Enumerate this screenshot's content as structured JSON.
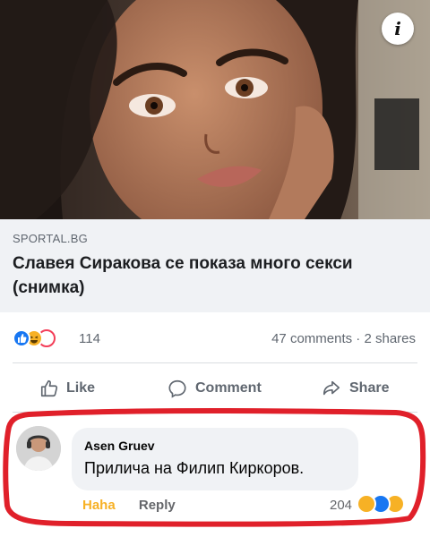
{
  "post": {
    "info_icon": "i",
    "source": "SPORTAL.BG",
    "headline": "Славея Сиракова се показа много секси (снимка)",
    "reaction_icons": [
      "like-icon",
      "haha-icon",
      "love-icon"
    ],
    "reaction_count": "114",
    "comments_shares": "47 comments · 2 shares"
  },
  "actions": {
    "like": "Like",
    "comment": "Comment",
    "share": "Share"
  },
  "comment": {
    "author": "Asen Gruev",
    "text": "Прилича на Филип Киркоров.",
    "haha_label": "Haha",
    "reply_label": "Reply",
    "reaction_count": "204",
    "reaction_icons": [
      "haha-icon",
      "like-icon",
      "care-icon"
    ]
  },
  "colors": {
    "facebook_blue": "#1877f2",
    "haha_yellow": "#f7b125",
    "highlight_red": "#e0202a",
    "link_box_bg": "#f0f2f5"
  }
}
